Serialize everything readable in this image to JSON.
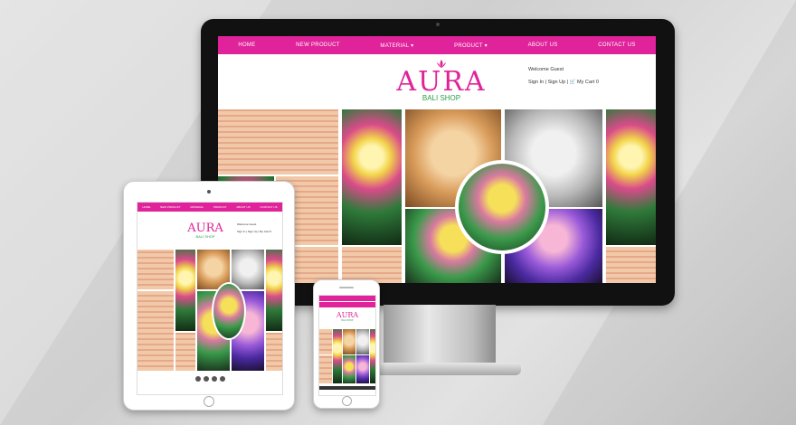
{
  "desktop": {
    "nav": [
      "HOME",
      "NEW PRODUCT",
      "MATERIAL ▾",
      "PRODUCT ▾",
      "ABOUT US",
      "CONTACT US"
    ],
    "logo": {
      "main": "AURA",
      "sub": "BALI SHOP"
    },
    "welcome": "Welcome Guest",
    "account": "Sign In | Sign Up | 🛒 My Cart 0"
  },
  "tablet": {
    "nav": [
      "HOME",
      "NEW PRODUCT",
      "MATERIAL",
      "PRODUCT",
      "ABOUT US",
      "CONTACT US"
    ],
    "logo": {
      "main": "AURA",
      "sub": "BALI SHOP"
    },
    "welcome": "Welcome Guest",
    "account": "Sign In | Sign Up | My Cart 0"
  },
  "phone": {
    "logo": {
      "main": "AURA",
      "sub": "BALI SHOP"
    }
  },
  "colors": {
    "brand_pink": "#e0239a",
    "logo_green": "#2aa04a"
  }
}
